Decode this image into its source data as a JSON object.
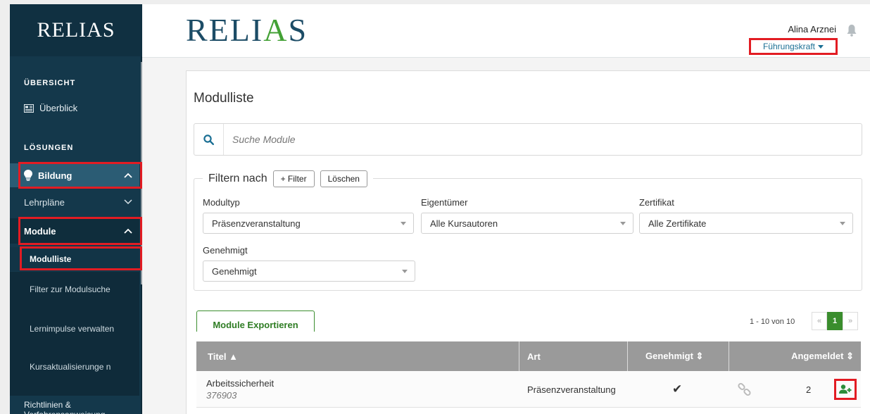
{
  "sidebar": {
    "logo": "RELIAS",
    "section_overview": "ÜBERSICHT",
    "overview_link": "Überblick",
    "section_solutions": "LÖSUNGEN",
    "bildung": "Bildung",
    "lehrplaene": "Lehrpläne",
    "module": "Module",
    "modulliste": "Modulliste",
    "filter_modulsuche": "Filter zur Modulsuche",
    "lernimpulse": "Lernimpulse verwalten",
    "kursaktualisierungen": "Kursaktualisierunge n",
    "richtlinien": "Richtlinien & Verfahrensanweisung"
  },
  "header": {
    "logo": "RELIAS",
    "user_name": "Alina Arznei",
    "role": "Führungskraft"
  },
  "main": {
    "title": "Modulliste",
    "search_placeholder": "Suche Module",
    "filter_label": "Filtern nach",
    "add_filter": "+ Filter",
    "clear": "Löschen",
    "filters": [
      {
        "label": "Modultyp",
        "value": "Präsenzveranstaltung"
      },
      {
        "label": "Eigentümer",
        "value": "Alle Kursautoren"
      },
      {
        "label": "Zertifikat",
        "value": "Alle Zertifikate"
      },
      {
        "label": "Genehmigt",
        "value": "Genehmigt"
      }
    ],
    "export": "Module Exportieren",
    "pager_text": "1 - 10 von 10",
    "pager": {
      "prev": "«",
      "current": "1",
      "next": "»"
    },
    "table": {
      "headers": [
        "Titel ▲",
        "Art",
        "Genehmigt ⇕",
        "Angemeldet ⇕"
      ],
      "rows": [
        {
          "title": "Arbeitssicherheit",
          "id": "376903",
          "art": "Präsenzveranstaltung",
          "genehmigt": "✔",
          "angemeldet": "2"
        }
      ]
    }
  },
  "colors": {
    "sidebar_bg": "#14384b",
    "accent_green": "#3a8d2d",
    "highlight_red": "#e21c23",
    "link_blue": "#1b6f94"
  }
}
